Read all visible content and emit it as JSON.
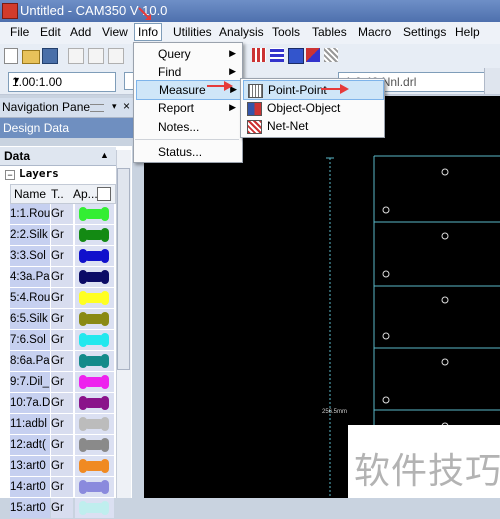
{
  "window": {
    "title": "Untitled - CAM350 V 10.0"
  },
  "menubar": [
    "File",
    "Edit",
    "Add",
    "View",
    "Info",
    "Utilities",
    "Analysis",
    "Tools",
    "Tables",
    "Macro",
    "Settings",
    "Help"
  ],
  "zoom": {
    "value": "1.00:1.00"
  },
  "layer_select": {
    "value": "1:0.40 Nnl.drl"
  },
  "nav_pane": {
    "title": "Navigation Pane",
    "close": "×",
    "design_data": "Design Data"
  },
  "data_panel": {
    "title": "Data",
    "layers_label": "Layers",
    "toggle": "−",
    "columns": {
      "name": "Name",
      "type": "T..",
      "appearance": "Ap..."
    },
    "layers": [
      {
        "name": "1:1.Rou",
        "type": "Gr",
        "color": "#33ee33"
      },
      {
        "name": "2:2.Silk",
        "type": "Gr",
        "color": "#138a13"
      },
      {
        "name": "3:3.Sol",
        "type": "Gr",
        "color": "#1010cc"
      },
      {
        "name": "4:3a.Pa",
        "type": "Gr",
        "color": "#0b0b66"
      },
      {
        "name": "5:4.Rou",
        "type": "Gr",
        "color": "#ffff22"
      },
      {
        "name": "6:5.Silk",
        "type": "Gr",
        "color": "#8a8a14"
      },
      {
        "name": "7:6.Sol",
        "type": "Gr",
        "color": "#22e8ee"
      },
      {
        "name": "8:6a.Pa",
        "type": "Gr",
        "color": "#138a8a"
      },
      {
        "name": "9:7.Dil_",
        "type": "Gr",
        "color": "#ee22ee"
      },
      {
        "name": "10:7a.D",
        "type": "Gr",
        "color": "#8a138a"
      },
      {
        "name": "11:adbl",
        "type": "Gr",
        "color": "#bcbcbc"
      },
      {
        "name": "12:adt(",
        "type": "Gr",
        "color": "#8a8a8a"
      },
      {
        "name": "13:art0",
        "type": "Gr",
        "color": "#f08a22"
      },
      {
        "name": "14:art0",
        "type": "Gr",
        "color": "#8a8add"
      },
      {
        "name": "15:art0",
        "type": "Gr",
        "color": "#bfeeee"
      }
    ]
  },
  "info_menu": {
    "items": [
      {
        "label": "Query",
        "submenu": true
      },
      {
        "label": "Find",
        "submenu": true
      },
      {
        "label": "Measure",
        "submenu": true
      },
      {
        "label": "Report",
        "submenu": true
      },
      {
        "label": "Notes...",
        "submenu": false
      },
      {
        "label": "Status...",
        "submenu": false
      }
    ]
  },
  "measure_menu": {
    "items": [
      "Point-Point",
      "Object-Object",
      "Net-Net"
    ]
  },
  "canvas": {
    "dimension_label": "256.5mm"
  },
  "watermark": "软件技巧"
}
